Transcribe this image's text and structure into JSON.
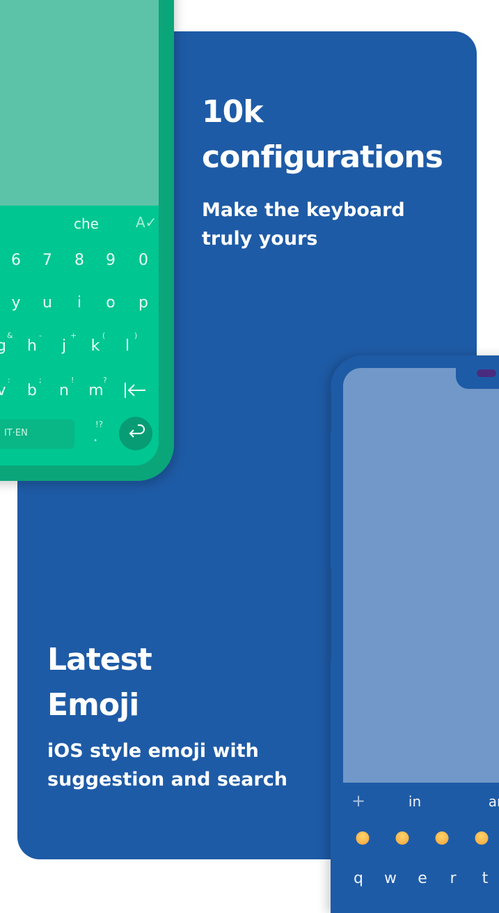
{
  "feature_top": {
    "title_line1": "10k",
    "title_line2": "configurations",
    "subtitle_line1": "Make the keyboard",
    "subtitle_line2": "truly yours"
  },
  "feature_bottom": {
    "title_line1": "Latest",
    "title_line2": "Emoji",
    "subtitle_line1": "iOS style emoji with",
    "subtitle_line2": "suggestion and search"
  },
  "green_keyboard": {
    "suggestion": "che",
    "spellcheck_icon": "spellcheck-icon",
    "number_row": [
      "6",
      "7",
      "8",
      "9",
      "0"
    ],
    "row1": [
      "y",
      "u",
      "i",
      "o",
      "p"
    ],
    "row2": [
      {
        "key": "g",
        "alt": "&"
      },
      {
        "key": "h",
        "alt": "-"
      },
      {
        "key": "j",
        "alt": "+"
      },
      {
        "key": "k",
        "alt": "("
      },
      {
        "key": "l",
        "alt": ")"
      }
    ],
    "row3": [
      {
        "key": "v",
        "alt": ":"
      },
      {
        "key": "b",
        "alt": ";"
      },
      {
        "key": "n",
        "alt": "!"
      },
      {
        "key": "m",
        "alt": "?"
      }
    ],
    "backspace_icon": "backspace-icon",
    "space_label": "IT·EN",
    "punct_main": ".",
    "punct_alt": "!?",
    "enter_icon": "enter-icon"
  },
  "blue_keyboard": {
    "plus_label": "+",
    "suggestions": [
      "in",
      "ar"
    ],
    "emoji": [
      "slightly-smiling-face",
      "face-savoring-food",
      "winking-face",
      "smiling-face"
    ],
    "row1": [
      "q",
      "w",
      "e",
      "r",
      "t"
    ]
  },
  "colors": {
    "panel_blue": "#1e5ba6",
    "green_keyboard": "#00c691",
    "green_frame": "#0ba57a",
    "blue_screen": "#7198c8"
  }
}
